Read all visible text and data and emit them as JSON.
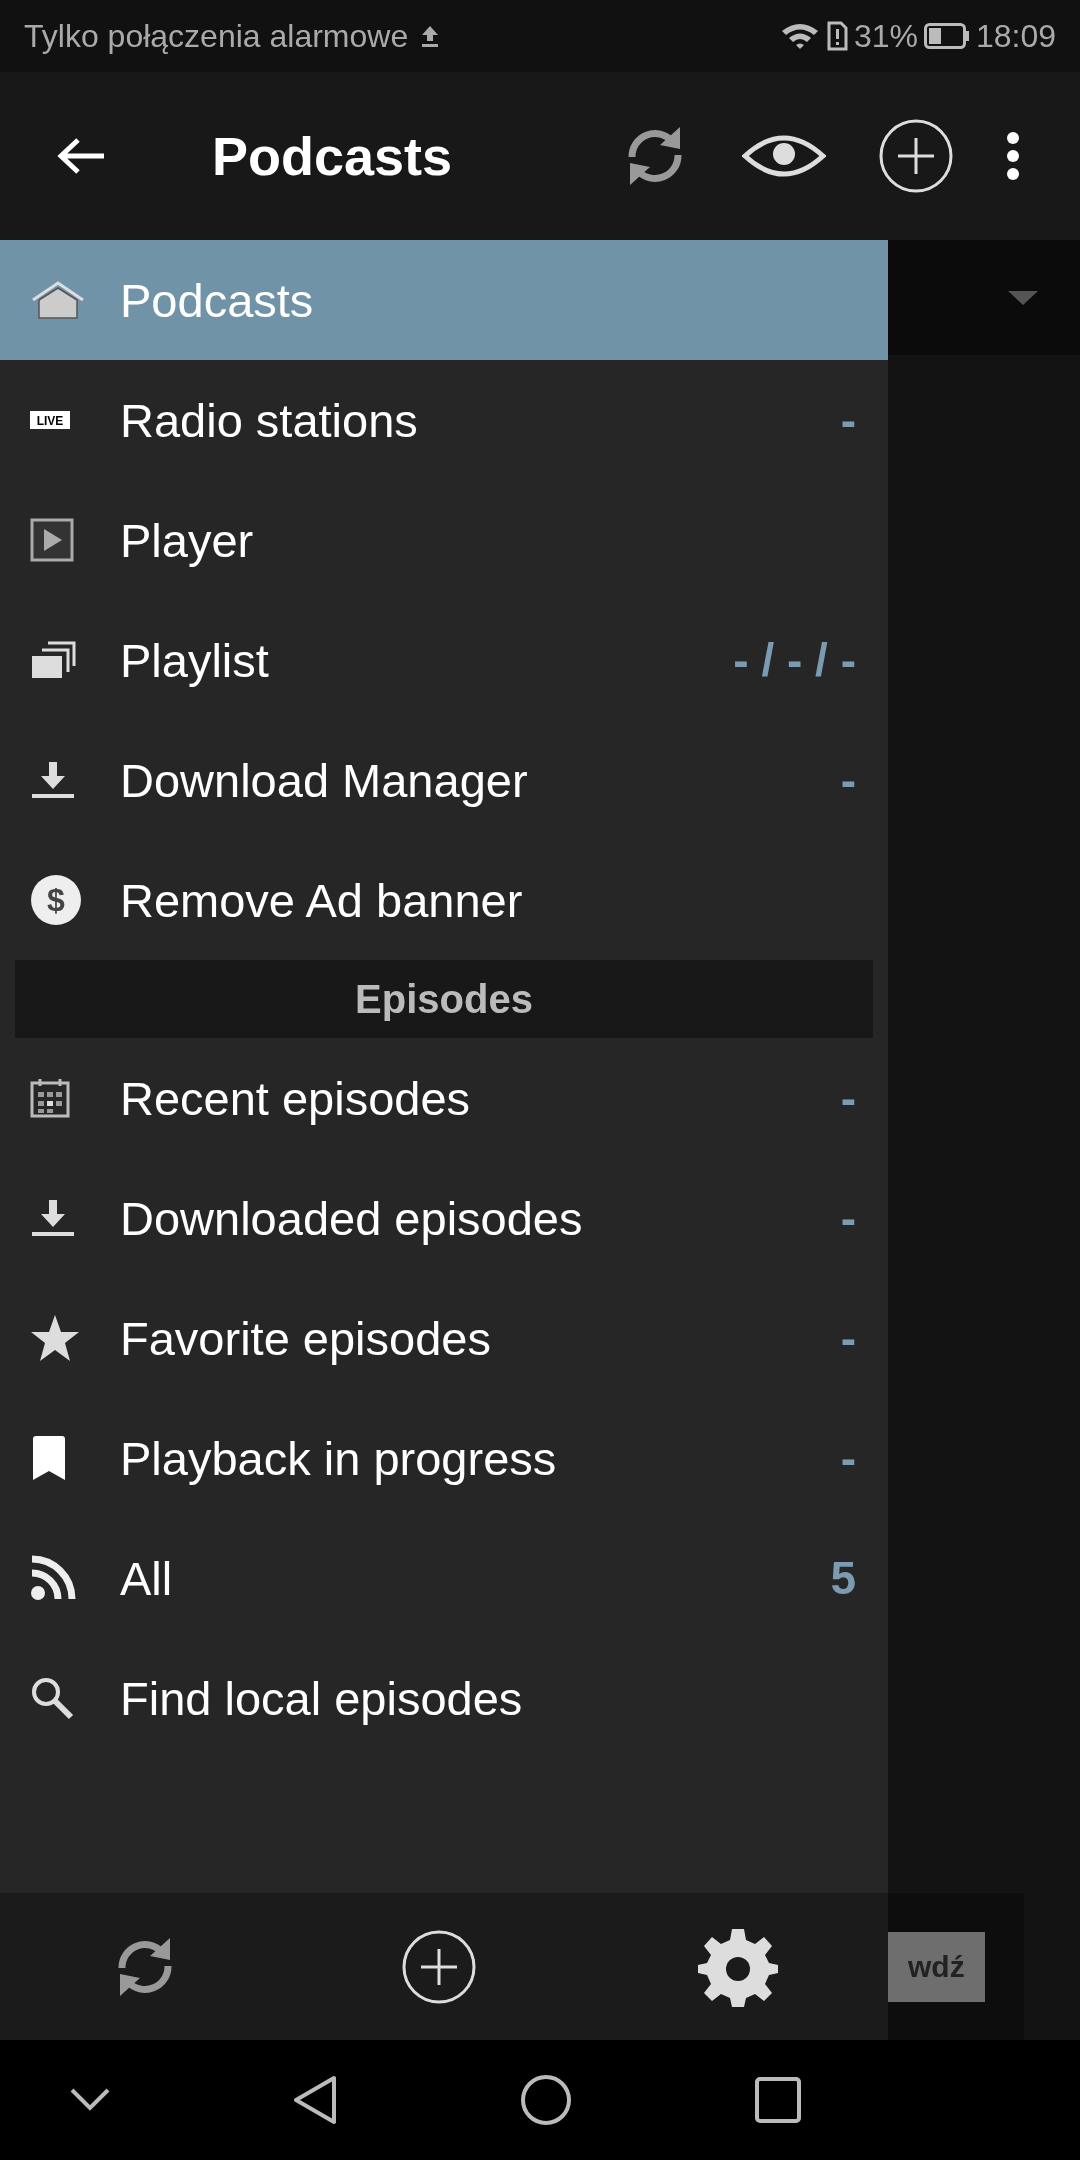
{
  "status_bar": {
    "notice": "Tylko połączenia alarmowe",
    "battery_text": "31%",
    "time": "18:09"
  },
  "app_bar": {
    "title": "Podcasts"
  },
  "drawer": {
    "sections": [
      {
        "items": [
          {
            "kind": "home",
            "label": "Podcasts",
            "selected": true
          },
          {
            "kind": "live",
            "icon_text": "LIVE",
            "label": "Radio stations",
            "count": "-",
            "selected": false
          },
          {
            "kind": "player",
            "label": "Player",
            "selected": false
          },
          {
            "kind": "playlist",
            "label": "Playlist",
            "count": "- / - / -",
            "selected": false
          },
          {
            "kind": "download",
            "label": "Download Manager",
            "count": "-",
            "selected": false
          },
          {
            "kind": "dollar",
            "icon_text": "$",
            "label": "Remove Ad banner",
            "selected": false
          }
        ]
      },
      {
        "title": "Episodes",
        "items": [
          {
            "kind": "calendar",
            "label": "Recent episodes",
            "count": "-",
            "selected": false
          },
          {
            "kind": "download",
            "label": "Downloaded episodes",
            "count": "-",
            "selected": false
          },
          {
            "kind": "star",
            "label": "Favorite episodes",
            "count": "-",
            "selected": false
          },
          {
            "kind": "bookmark",
            "label": "Playback in progress",
            "count": "-",
            "selected": false
          },
          {
            "kind": "rss",
            "label": "All",
            "count": "5",
            "selected": false
          },
          {
            "kind": "search",
            "label": "Find local episodes",
            "selected": false
          }
        ]
      }
    ]
  },
  "background": {
    "button_text": "wdź"
  }
}
